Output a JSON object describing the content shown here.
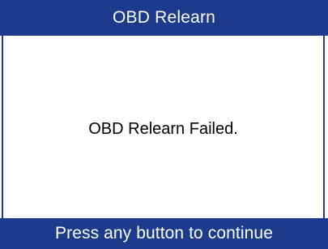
{
  "header": {
    "title": "OBD Relearn"
  },
  "main": {
    "message": "OBD Relearn Failed."
  },
  "footer": {
    "prompt": "Press any button to continue"
  },
  "colors": {
    "bar_background": "#1c3b8c",
    "bar_text": "#ffffff",
    "content_background": "#ffffff",
    "message_text": "#000000"
  }
}
